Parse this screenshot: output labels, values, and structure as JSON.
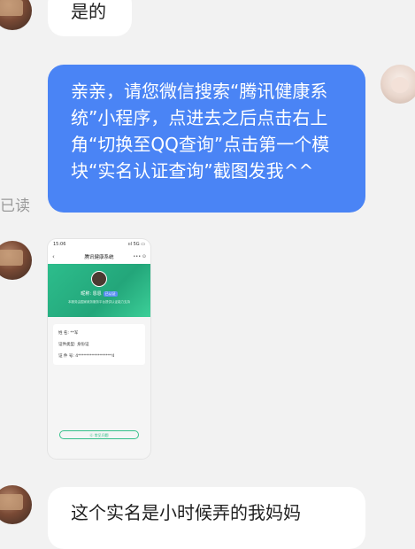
{
  "messages": {
    "first_text": "是的",
    "blue_text": "亲亲，请您微信搜索“腾讯健康系统”小程序，点进去之后点击右上角“切换至QQ查询”点击第一个模块“实名认证查询”截图发我^^",
    "read_status": "已读",
    "last_text": "这个实名是小时候弄的我妈妈"
  },
  "screenshot": {
    "time": "15:06",
    "signal": "ııl 5G ▭",
    "nav_title": "腾讯健康系统",
    "nav_caps": "••• ⊙",
    "name_line": "昵称: 恩恩",
    "badge": "已认证",
    "note": "本服务由国家政务服务平台提供认证能力支持",
    "row1": "姓    名:  **军",
    "row2": "证件类型:  身份证",
    "row3": "证 件 号:  4*****************4",
    "button": "⓪ 常见问题"
  }
}
